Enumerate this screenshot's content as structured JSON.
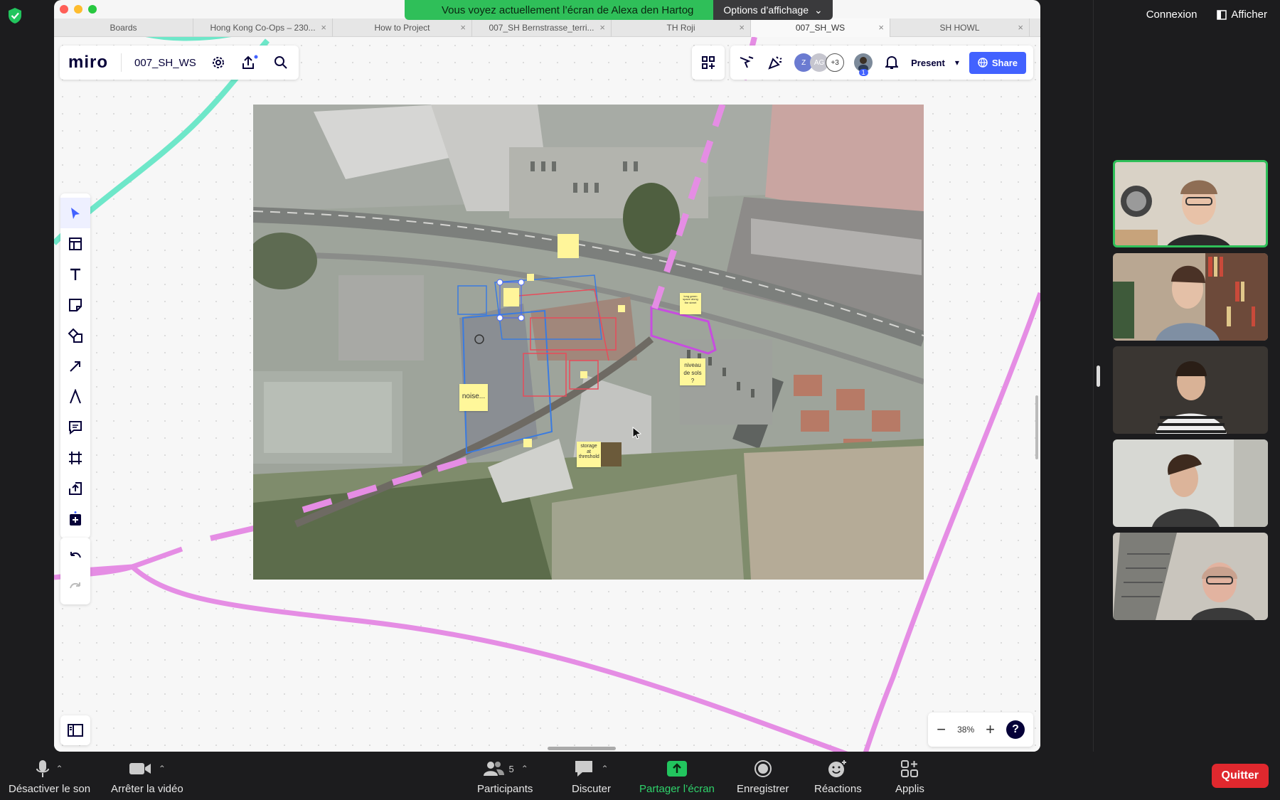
{
  "zoom": {
    "share_banner": "Vous voyez actuellement l’écran de Alexa den Hartog",
    "view_options": "Options d’affichage",
    "top_right": {
      "connexion": "Connexion",
      "afficher": "Afficher"
    },
    "bottom": {
      "mute": "Désactiver le son",
      "video": "Arrêter la vidéo",
      "participants": "Participants",
      "participants_count": "5",
      "chat": "Discuter",
      "share": "Partager l’écran",
      "record": "Enregistrer",
      "reactions": "Réactions",
      "apps": "Applis",
      "quit": "Quitter"
    },
    "colors": {
      "accent_green": "#2fbf59",
      "quit_red": "#e0282e",
      "share_green": "#22c55e"
    }
  },
  "browser": {
    "tabs": [
      {
        "label": "Boards"
      },
      {
        "label": "Hong Kong Co-Ops – 230..."
      },
      {
        "label": "How to Project"
      },
      {
        "label": "007_SH Bernstrasse_terri..."
      },
      {
        "label": "TH Roji"
      },
      {
        "label": "007_SH_WS"
      },
      {
        "label": "SH HOWL"
      }
    ]
  },
  "miro": {
    "logo": "miro",
    "board_name": "007_SH_WS",
    "avatars": {
      "a1": "Z",
      "a2": "AG",
      "more": "+3",
      "viewers": "1"
    },
    "present": "Present",
    "share": "Share",
    "zoom_level": "38%",
    "help": "?",
    "stickies": {
      "noise": "noise...",
      "niveau": "niveau de sols ?",
      "storage": "storage at threshold",
      "long": "long green space along the street"
    },
    "colors": {
      "brand": "#050038",
      "share_blue": "#4262ff",
      "teal_line": "#6ee7c9",
      "pink_line": "#e58de4"
    }
  }
}
